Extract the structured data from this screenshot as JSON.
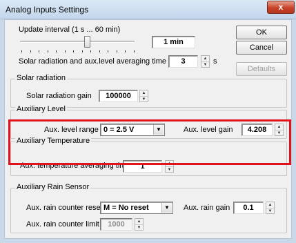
{
  "window": {
    "title": "Analog Inputs Settings",
    "close_label": "x"
  },
  "buttons": {
    "ok": "OK",
    "cancel": "Cancel",
    "defaults": "Defaults"
  },
  "update": {
    "interval_label": "Update interval (1 s ... 60 min)",
    "interval_value": "1 min",
    "averaging_label": "Solar radiation and aux.level averaging time",
    "averaging_value": "3",
    "averaging_unit": "s"
  },
  "solar": {
    "title": "Solar radiation",
    "gain_label": "Solar radiation gain",
    "gain_value": "100000"
  },
  "aux_level": {
    "title": "Auxiliary Level",
    "range_label": "Aux. level range",
    "range_value": "0 = 2.5 V",
    "gain_label": "Aux. level gain",
    "gain_value": "4.208"
  },
  "aux_temp": {
    "title": "Auxiliary Temperature",
    "averaging_label": "Aux. temperature averaging time",
    "averaging_value": "1"
  },
  "aux_rain": {
    "title": "Auxiliary Rain Sensor",
    "reset_label": "Aux. rain counter reset",
    "reset_value": "M = No reset",
    "gain_label": "Aux. rain gain",
    "gain_value": "0.1",
    "limit_label": "Aux. rain counter limit",
    "limit_value": "1000"
  },
  "colors": {
    "highlight": "#e0141e",
    "close_button": "#c7432a"
  },
  "icons": {
    "spin_up": "spin-up-icon",
    "spin_down": "spin-down-icon",
    "dropdown": "chevron-down-icon"
  }
}
